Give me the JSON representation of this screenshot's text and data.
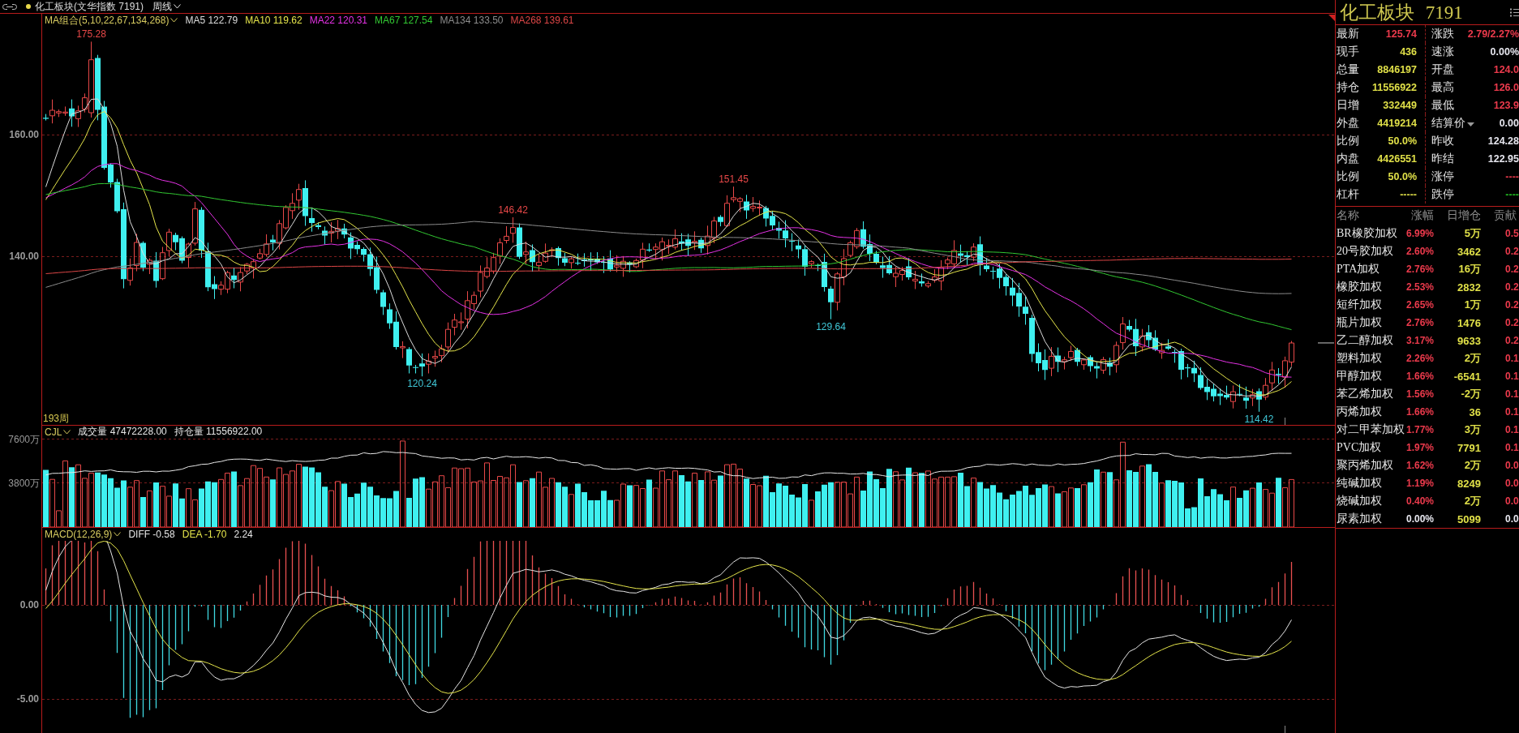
{
  "header": {
    "title": "化工板块(文华指数 7191)",
    "period": "周线"
  },
  "price_chart": {
    "indicator": "MA组合(5,10,22,67,134,268)",
    "moving_averages": [
      {
        "label": "MA5 122.79",
        "color": "#dcdcdc"
      },
      {
        "label": "MA10 119.62",
        "color": "#e6e64b"
      },
      {
        "label": "MA22 120.31",
        "color": "#e632e6"
      },
      {
        "label": "MA67 127.54",
        "color": "#32c832"
      },
      {
        "label": "MA134 133.50",
        "color": "#8c8c8c"
      },
      {
        "label": "MA268 139.61",
        "color": "#dc4646"
      }
    ],
    "y_axis": [
      "160.00",
      "140.00"
    ],
    "price_labels": [
      {
        "text": "175.28",
        "kind": "high"
      },
      {
        "text": "120.24",
        "kind": "low"
      },
      {
        "text": "146.42",
        "kind": "high"
      },
      {
        "text": "151.45",
        "kind": "high"
      },
      {
        "text": "129.64",
        "kind": "low"
      },
      {
        "text": "114.42",
        "kind": "low"
      }
    ],
    "bar_count": "193周"
  },
  "volume_chart": {
    "indicator": "CJL",
    "readings": [
      "成交量 47472228.00",
      "持仓量 11556922.00"
    ],
    "y_axis": [
      "7600万",
      "3800万"
    ]
  },
  "macd_chart": {
    "indicator": "MACD(12,26,9)",
    "readings": [
      {
        "text": "DIFF -0.58",
        "color": "#e6e6e6"
      },
      {
        "text": "DEA -1.70",
        "color": "#e6e64b"
      },
      {
        "text": "2.24",
        "color": "#e6e6e6"
      }
    ],
    "y_axis": [
      "0.00",
      "-5.00"
    ]
  },
  "quote_panel": {
    "title": "化工板块 7191",
    "rows": [
      [
        {
          "label": "最新",
          "value": "125.74",
          "color": "#ec3a4c",
          "kind": "plain"
        },
        {
          "label": "涨跌",
          "value": "2.79/2.27%",
          "color": "#ec3a4c",
          "kind": "plain"
        }
      ],
      [
        {
          "label": "现手",
          "value": "436",
          "color": "#e0e048",
          "kind": "plain"
        },
        {
          "label": "速涨",
          "value": "0.00%",
          "color": "#e6e6ee",
          "kind": "plain"
        }
      ],
      [
        {
          "label": "总量",
          "value": "8846197",
          "color": "#e0e048",
          "kind": "plain"
        },
        {
          "label": "开盘",
          "value": "124.0",
          "color": "#ec3a4c",
          "kind": "plain"
        }
      ],
      [
        {
          "label": "持仓",
          "value": "11556922",
          "color": "#e0e048",
          "kind": "plain"
        },
        {
          "label": "最高",
          "value": "126.0",
          "color": "#ec3a4c",
          "kind": "plain"
        }
      ],
      [
        {
          "label": "日增",
          "value": "332449",
          "color": "#e0e048",
          "kind": "plain"
        },
        {
          "label": "最低",
          "value": "123.9",
          "color": "#ec3a4c",
          "kind": "plain"
        }
      ],
      [
        {
          "label": "外盘",
          "value": "4419214",
          "color": "#e0e048",
          "kind": "plain"
        },
        {
          "label": "结算价",
          "value": "0.00",
          "color": "#e6e6ee",
          "kind": "dropdown"
        }
      ],
      [
        {
          "label": "比例",
          "value": "50.0%",
          "color": "#e0e048",
          "kind": "plain"
        },
        {
          "label": "昨收",
          "value": "124.28",
          "color": "#e6e6ee",
          "kind": "plain"
        }
      ],
      [
        {
          "label": "内盘",
          "value": "4426551",
          "color": "#e0e048",
          "kind": "plain"
        },
        {
          "label": "昨结",
          "value": "122.95",
          "color": "#e6e6ee",
          "kind": "plain"
        }
      ],
      [
        {
          "label": "比例",
          "value": "50.0%",
          "color": "#e0e048",
          "kind": "plain"
        },
        {
          "label": "涨停",
          "value": "----",
          "color": "#ec3a4c",
          "kind": "plain"
        }
      ],
      [
        {
          "label": "杠杆",
          "value": "-----",
          "color": "#e0e048",
          "kind": "plain"
        },
        {
          "label": "跌停",
          "value": "----",
          "color": "#22c022",
          "kind": "plain"
        }
      ]
    ]
  },
  "constituents": {
    "columns": [
      "名称",
      "涨幅",
      "日增仓",
      "贡献"
    ],
    "rows": [
      {
        "name": "BR橡胶加权",
        "change": {
          "text": "6.99%",
          "color": "#ec3a4c"
        },
        "oi_change": "5万",
        "contribution": {
          "text": "0.5",
          "color": "#ec3a4c"
        }
      },
      {
        "name": "20号胶加权",
        "change": {
          "text": "2.60%",
          "color": "#ec3a4c"
        },
        "oi_change": "3462",
        "contribution": {
          "text": "0.2",
          "color": "#ec3a4c"
        }
      },
      {
        "name": "PTA加权",
        "change": {
          "text": "2.76%",
          "color": "#ec3a4c"
        },
        "oi_change": "16万",
        "contribution": {
          "text": "0.2",
          "color": "#ec3a4c"
        }
      },
      {
        "name": "橡胶加权",
        "change": {
          "text": "2.53%",
          "color": "#ec3a4c"
        },
        "oi_change": "2832",
        "contribution": {
          "text": "0.2",
          "color": "#ec3a4c"
        }
      },
      {
        "name": "短纤加权",
        "change": {
          "text": "2.65%",
          "color": "#ec3a4c"
        },
        "oi_change": "1万",
        "contribution": {
          "text": "0.2",
          "color": "#ec3a4c"
        }
      },
      {
        "name": "瓶片加权",
        "change": {
          "text": "2.76%",
          "color": "#ec3a4c"
        },
        "oi_change": "1476",
        "contribution": {
          "text": "0.2",
          "color": "#ec3a4c"
        }
      },
      {
        "name": "乙二醇加权",
        "change": {
          "text": "3.17%",
          "color": "#ec3a4c"
        },
        "oi_change": "9633",
        "contribution": {
          "text": "0.2",
          "color": "#ec3a4c"
        }
      },
      {
        "name": "塑料加权",
        "change": {
          "text": "2.26%",
          "color": "#ec3a4c"
        },
        "oi_change": "2万",
        "contribution": {
          "text": "0.1",
          "color": "#ec3a4c"
        }
      },
      {
        "name": "甲醇加权",
        "change": {
          "text": "1.66%",
          "color": "#ec3a4c"
        },
        "oi_change": "-6541",
        "contribution": {
          "text": "0.1",
          "color": "#ec3a4c"
        }
      },
      {
        "name": "苯乙烯加权",
        "change": {
          "text": "1.56%",
          "color": "#ec3a4c"
        },
        "oi_change": "-2万",
        "contribution": {
          "text": "0.1",
          "color": "#ec3a4c"
        }
      },
      {
        "name": "丙烯加权",
        "change": {
          "text": "1.66%",
          "color": "#ec3a4c"
        },
        "oi_change": "36",
        "contribution": {
          "text": "0.1",
          "color": "#ec3a4c"
        }
      },
      {
        "name": "对二甲苯加权",
        "change": {
          "text": "1.77%",
          "color": "#ec3a4c"
        },
        "oi_change": "3万",
        "contribution": {
          "text": "0.1",
          "color": "#ec3a4c"
        }
      },
      {
        "name": "PVC加权",
        "change": {
          "text": "1.97%",
          "color": "#ec3a4c"
        },
        "oi_change": "7791",
        "contribution": {
          "text": "0.1",
          "color": "#ec3a4c"
        }
      },
      {
        "name": "聚丙烯加权",
        "change": {
          "text": "1.62%",
          "color": "#ec3a4c"
        },
        "oi_change": "2万",
        "contribution": {
          "text": "0.0",
          "color": "#ec3a4c"
        }
      },
      {
        "name": "纯碱加权",
        "change": {
          "text": "1.19%",
          "color": "#ec3a4c"
        },
        "oi_change": "8249",
        "contribution": {
          "text": "0.0",
          "color": "#ec3a4c"
        }
      },
      {
        "name": "烧碱加权",
        "change": {
          "text": "0.40%",
          "color": "#ec3a4c"
        },
        "oi_change": "2万",
        "contribution": {
          "text": "0.0",
          "color": "#ec3a4c"
        }
      },
      {
        "name": "尿素加权",
        "change": {
          "text": "0.00%",
          "color": "#e6e6ee"
        },
        "oi_change": "5099",
        "contribution": {
          "text": "0.0",
          "color": "#e6e6ee"
        }
      }
    ]
  }
}
